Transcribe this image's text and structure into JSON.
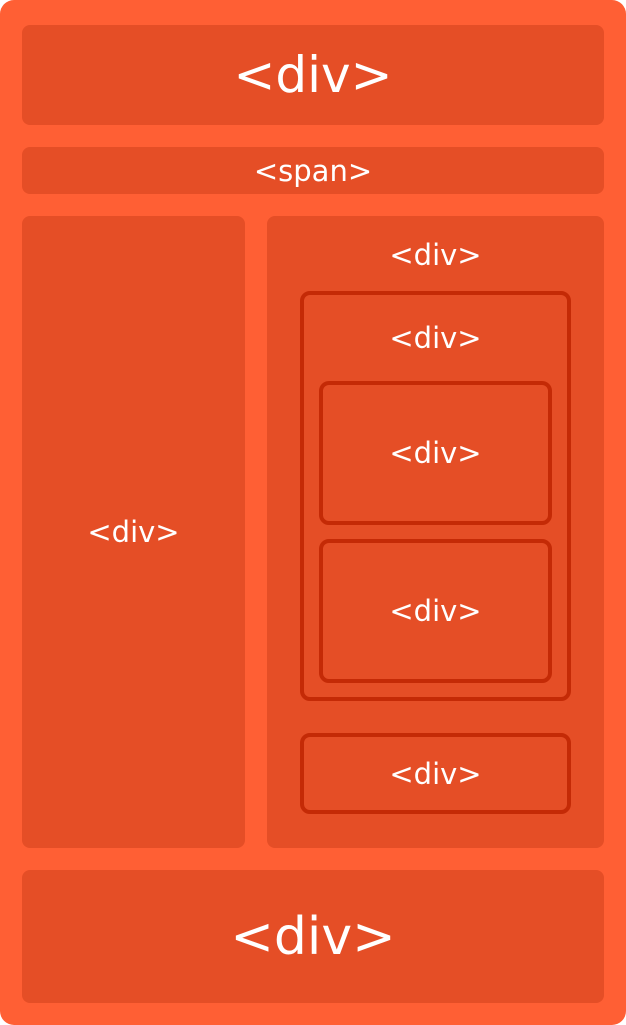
{
  "diagram": {
    "header_label": "<div>",
    "span_label": "<span>",
    "left_column_label": "<div>",
    "right_column": {
      "label": "<div>",
      "inner_container": {
        "label": "<div>",
        "child_1_label": "<div>",
        "child_2_label": "<div>"
      },
      "bottom_box_label": "<div>"
    },
    "footer_label": "<div>"
  },
  "colors": {
    "frame": "#ff5f34",
    "block": "#e54e26",
    "outline": "#c42a06",
    "text": "#ffffff"
  }
}
